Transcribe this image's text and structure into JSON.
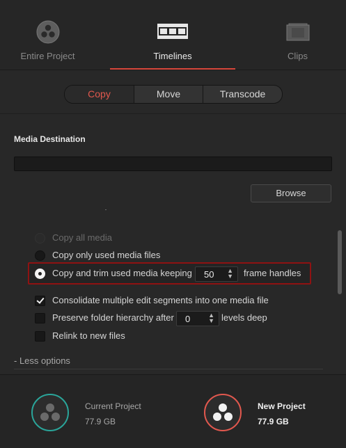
{
  "tabs": [
    {
      "label": "Entire Project",
      "icon": "davinci-logo-icon",
      "active": false
    },
    {
      "label": "Timelines",
      "icon": "timeline-filmstrip-icon",
      "active": true
    },
    {
      "label": "Clips",
      "icon": "clips-filmstrip-icon",
      "active": false
    }
  ],
  "mode": {
    "options": [
      "Copy",
      "Move",
      "Transcode"
    ],
    "selected": "Copy"
  },
  "media_destination": {
    "title": "Media Destination",
    "path_value": "",
    "browse_label": "Browse"
  },
  "options": {
    "copy_all": "Copy all media",
    "copy_used": "Copy only used media files",
    "copy_trim_prefix": "Copy and trim used media keeping",
    "frame_handles_value": "50",
    "copy_trim_suffix": "frame handles",
    "consolidate": "Consolidate multiple edit segments into one media file",
    "preserve_prefix": "Preserve folder hierarchy after",
    "levels_value": "0",
    "preserve_suffix": "levels deep",
    "relink": "Relink to new files",
    "less_options": "- Less options"
  },
  "footer": {
    "current": {
      "name": "Current Project",
      "size": "77.9 GB"
    },
    "new": {
      "name": "New Project",
      "size": "77.9 GB"
    }
  },
  "colors": {
    "accent_red": "#e2584e",
    "teal": "#2aa59a",
    "highlight_border": "#8f1212"
  }
}
